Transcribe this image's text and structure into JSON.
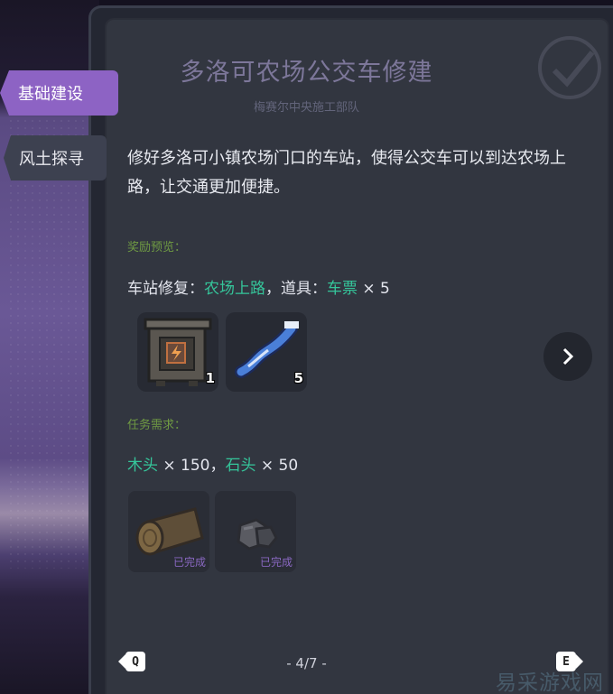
{
  "tabs": {
    "active_label": "基础建设",
    "inactive_label": "风土探寻"
  },
  "quest": {
    "title": "多洛可农场公交车修建",
    "issuer": "梅赛尔中央施工部队",
    "description": "修好多洛可小镇农场门口的车站，使得公交车可以到达农场上路，让交通更加便捷。"
  },
  "rewards": {
    "label": "奖励预览：",
    "text_prefix": "车站修复：",
    "location": "农场上路",
    "text_mid": "，道具：",
    "item_name": "车票",
    "item_qty": " × 5",
    "items": [
      {
        "icon": "station-box-icon",
        "count": "1"
      },
      {
        "icon": "ticket-icon",
        "count": "5"
      }
    ]
  },
  "requirements": {
    "label": "任务需求：",
    "wood_name": "木头",
    "wood_qty": " × 150",
    "sep": "，",
    "stone_name": "石头",
    "stone_qty": " × 50",
    "items": [
      {
        "icon": "wood-log-icon",
        "status": "已完成"
      },
      {
        "icon": "stone-icon",
        "status": "已完成"
      }
    ]
  },
  "pagination": {
    "prev_key": "Q",
    "next_key": "E",
    "page_text": "- 4/7 -"
  },
  "watermark": "易采游戏网",
  "colors": {
    "accent_purple": "#8d63c4",
    "highlight_green": "#35c59a",
    "section_label_green": "#6f9a43",
    "panel_bg": "#323640"
  }
}
